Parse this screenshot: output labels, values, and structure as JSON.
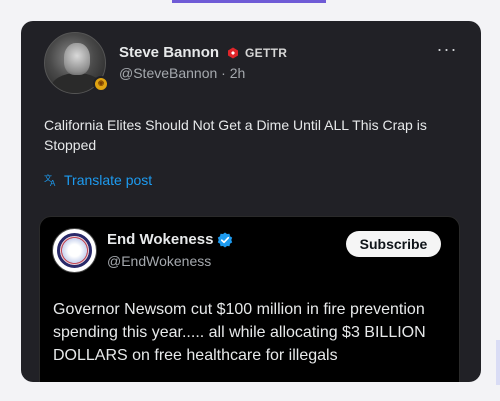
{
  "post": {
    "author_name": "Steve Bannon",
    "affiliation_label": "GETTR",
    "handle": "@SteveBannon",
    "separator": "·",
    "time": "2h",
    "more_label": "···",
    "text": "California Elites Should Not Get a Dime Until ALL This Crap is Stopped",
    "translate_label": "Translate post"
  },
  "quoted": {
    "author_name": "End Wokeness",
    "handle": "@EndWokeness",
    "subscribe_label": "Subscribe",
    "text": "Governor Newsom cut $100 million in fire prevention spending this year..... all while allocating $3 BILLION DOLLARS on free healthcare for illegals"
  },
  "colors": {
    "card_bg": "#212126",
    "link_blue": "#1d9bf0",
    "gettr_red": "#e0252a",
    "verified_blue": "#1d9bf0"
  },
  "icons": [
    "gettr-icon",
    "translate-icon",
    "verified-badge-icon",
    "more-icon"
  ]
}
